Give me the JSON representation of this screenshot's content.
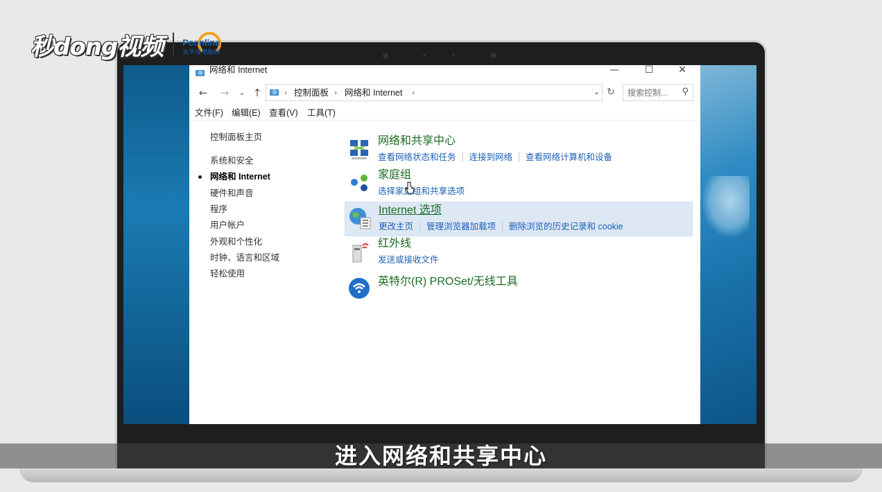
{
  "watermark": {
    "brand": "秒dong视频",
    "partner_logo": "Pconline",
    "partner_sub": "太平洋电脑网"
  },
  "window": {
    "title": "网络和 Internet",
    "controls": {
      "minimize": "—",
      "maximize": "☐",
      "close": "✕"
    }
  },
  "navbar": {
    "back": "←",
    "forward": "→",
    "recent": "⌄",
    "up": "↑",
    "breadcrumbs": [
      "控制面板",
      "网络和 Internet"
    ],
    "separator": "›",
    "dropdown": "⌄",
    "refresh": "↻",
    "search_placeholder": "搜索控制...",
    "search_icon": "⚲"
  },
  "menubar": [
    "文件(F)",
    "编辑(E)",
    "查看(V)",
    "工具(T)"
  ],
  "left_pane": {
    "home": "控制面板主页",
    "items": [
      "系统和安全",
      "网络和 Internet",
      "硬件和声音",
      "程序",
      "用户帐户",
      "外观和个性化",
      "时钟、语言和区域",
      "轻松使用"
    ],
    "active_index": 1
  },
  "categories": [
    {
      "icon": "network-sharing-icon",
      "title": "网络和共享中心",
      "links": [
        "查看网络状态和任务",
        "连接到网络",
        "查看网络计算机和设备"
      ]
    },
    {
      "icon": "homegroup-icon",
      "title": "家庭组",
      "links": [
        "选择家庭组和共享选项"
      ]
    },
    {
      "icon": "internet-options-icon",
      "title": "Internet 选项",
      "links": [
        "更改主页",
        "管理浏览器加载项",
        "删除浏览的历史记录和 cookie"
      ]
    },
    {
      "icon": "infrared-icon",
      "title": "红外线",
      "links": [
        "发送或接收文件"
      ]
    },
    {
      "icon": "wireless-icon",
      "title": "英特尔(R) PROSet/无线工具",
      "links": []
    }
  ],
  "subtitle": "进入网络和共享中心",
  "colors": {
    "category_title": "#1a6b1f",
    "link": "#1d5fb5",
    "highlight": "#dde8f4"
  }
}
